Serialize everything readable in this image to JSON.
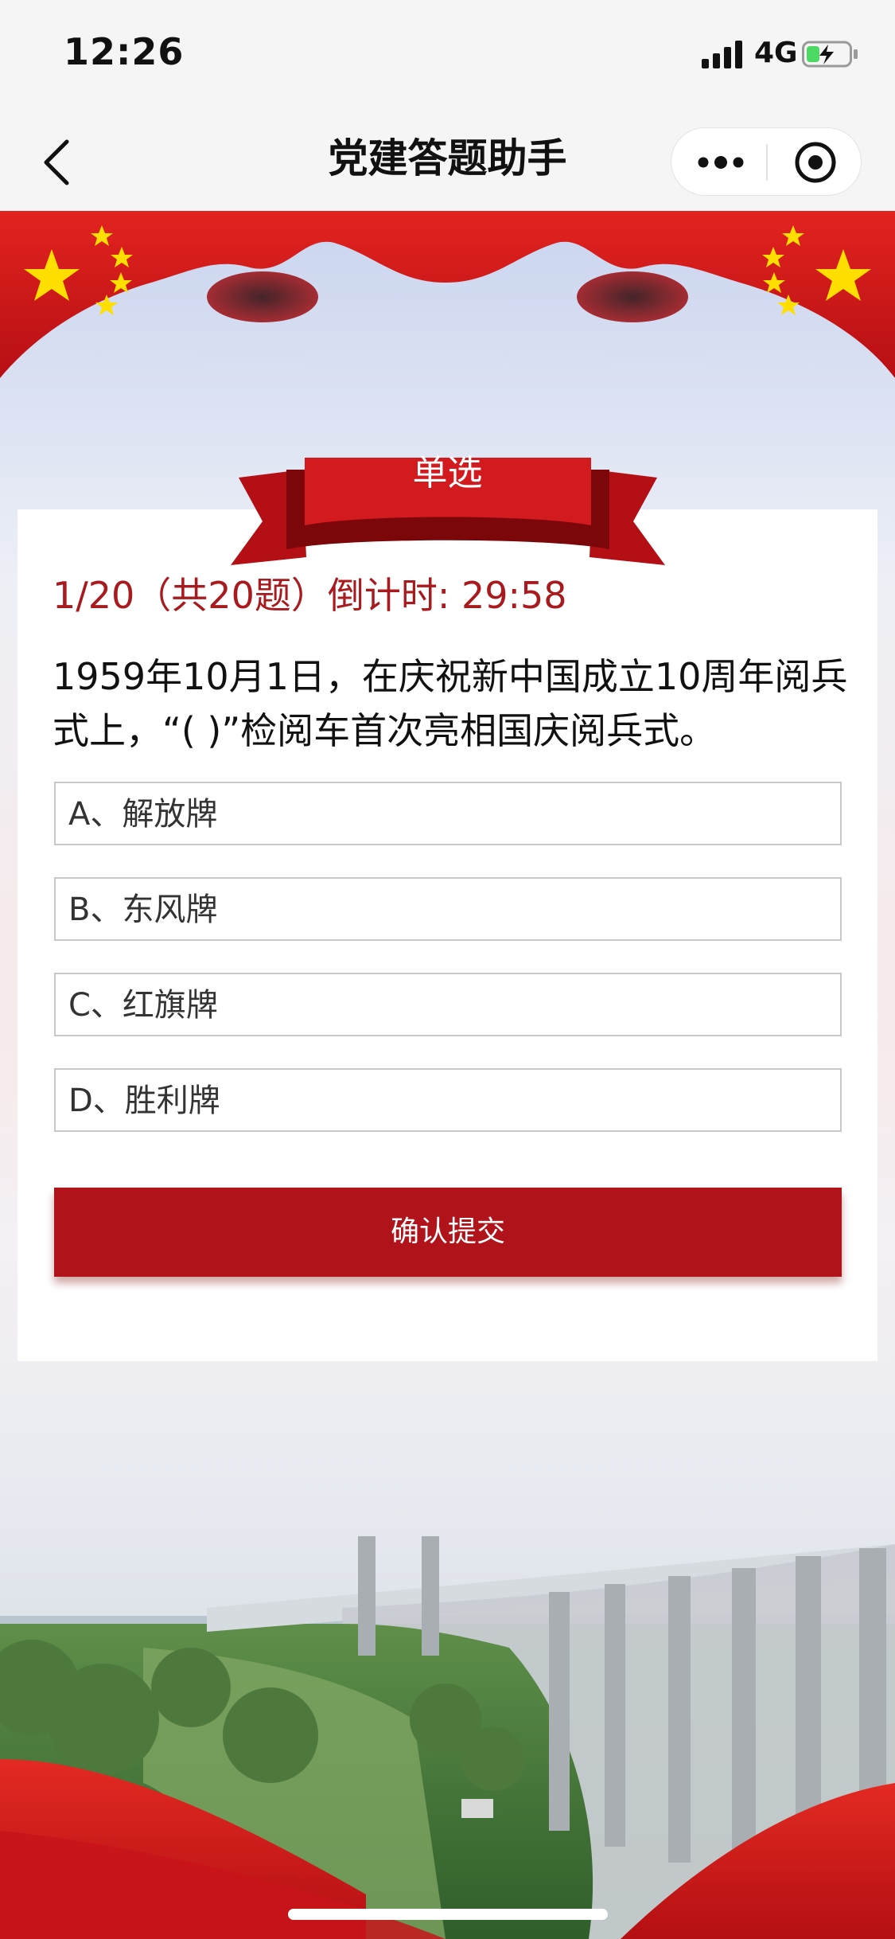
{
  "status_bar": {
    "time": "12:26",
    "network": "4G"
  },
  "nav": {
    "title": "党建答题助手",
    "back_icon": "chevron-left-icon",
    "more_icon": "more-dots-icon",
    "close_icon": "target-close-icon"
  },
  "quiz": {
    "type_label": "单选",
    "progress_text": "1/20（共20题）倒计时: 29:58",
    "question": "1959年10月1日，在庆祝新中国成立10周年阅兵式上，“( )”检阅车首次亮相国庆阅兵式。",
    "options": [
      {
        "label": "A、解放牌"
      },
      {
        "label": "B、东风牌"
      },
      {
        "label": "C、红旗牌"
      },
      {
        "label": "D、胜利牌"
      }
    ],
    "submit_label": "确认提交"
  },
  "colors": {
    "accent": "#b1131b",
    "progress_text": "#a81a1e",
    "flag_red": "#d71a1e",
    "star_yellow": "#ffde00"
  }
}
